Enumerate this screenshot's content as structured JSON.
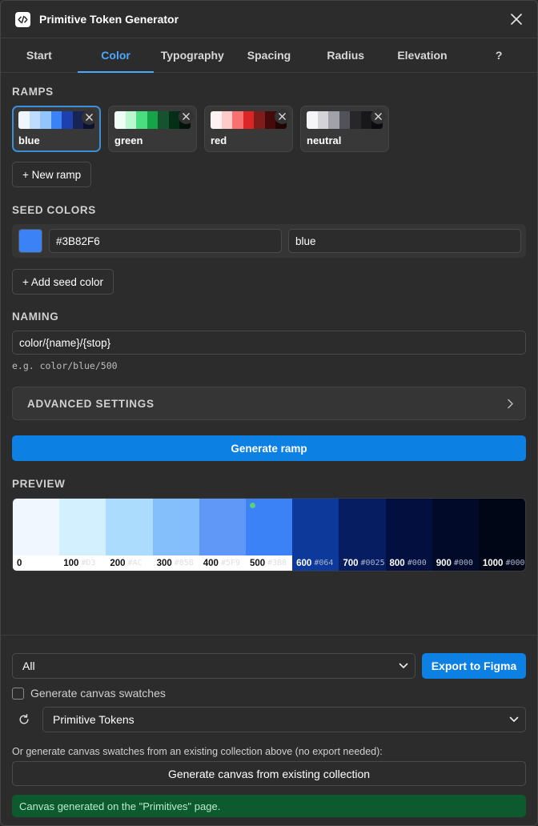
{
  "app": {
    "title": "Primitive Token Generator"
  },
  "tabs": [
    {
      "label": "Start"
    },
    {
      "label": "Color"
    },
    {
      "label": "Typography"
    },
    {
      "label": "Spacing"
    },
    {
      "label": "Radius"
    },
    {
      "label": "Elevation"
    },
    {
      "label": "?"
    }
  ],
  "active_tab": "Color",
  "ramps": {
    "label": "RAMPS",
    "items": [
      {
        "name": "blue",
        "selected": true,
        "colors": [
          "#eff6ff",
          "#bfdbfe",
          "#93c5fd",
          "#3b82f6",
          "#1e40af",
          "#172554",
          "#0b1230"
        ]
      },
      {
        "name": "green",
        "selected": false,
        "colors": [
          "#f0fdf4",
          "#bbf7d0",
          "#4ade80",
          "#16a34a",
          "#14532d",
          "#052e16",
          "#02140a"
        ]
      },
      {
        "name": "red",
        "selected": false,
        "colors": [
          "#fef2f2",
          "#fecaca",
          "#f87171",
          "#dc2626",
          "#7f1d1d",
          "#450a0a",
          "#200505"
        ]
      },
      {
        "name": "neutral",
        "selected": false,
        "colors": [
          "#f5f5f7",
          "#d4d4d8",
          "#a1a1aa",
          "#52525b",
          "#27272a",
          "#18181b",
          "#0c0c0e"
        ]
      }
    ],
    "new_label": "+ New ramp"
  },
  "seed": {
    "label": "SEED COLORS",
    "color": "#3B82F6",
    "hex": "#3B82F6",
    "name": "blue",
    "add_label": "+ Add seed color"
  },
  "naming": {
    "label": "NAMING",
    "pattern": "color/{name}/{stop}",
    "example": "e.g. color/blue/500"
  },
  "advanced": {
    "label": "ADVANCED SETTINGS"
  },
  "generate_label": "Generate ramp",
  "preview": {
    "label": "PREVIEW",
    "stops": [
      {
        "stop": "0",
        "hex": "",
        "color": "#f1f7ff",
        "dark": false
      },
      {
        "stop": "100",
        "hex": "#D3",
        "color": "#d3f0fe",
        "dark": false
      },
      {
        "stop": "200",
        "hex": "#AC",
        "color": "#acdcfd",
        "dark": false
      },
      {
        "stop": "300",
        "hex": "#85B",
        "color": "#85bffb",
        "dark": false
      },
      {
        "stop": "400",
        "hex": "#5F9",
        "color": "#5f98f7",
        "dark": false
      },
      {
        "stop": "500",
        "hex": "#3B8",
        "color": "#3b82f6",
        "dark": false,
        "seed": true
      },
      {
        "stop": "600",
        "hex": "#064",
        "color": "#0d3a9a",
        "dark": true
      },
      {
        "stop": "700",
        "hex": "#0025",
        "color": "#061d62",
        "dark": true
      },
      {
        "stop": "800",
        "hex": "#000",
        "color": "#030f3f",
        "dark": true
      },
      {
        "stop": "900",
        "hex": "#000",
        "color": "#020a29",
        "dark": true
      },
      {
        "stop": "1000",
        "hex": "#000",
        "color": "#010617",
        "dark": true
      }
    ]
  },
  "footer": {
    "scope_value": "All",
    "export_label": "Export to Figma",
    "swatches_label": "Generate canvas swatches",
    "collection_value": "Primitive Tokens",
    "or_text": "Or generate canvas swatches from an existing collection above (no export needed):",
    "from_collection_label": "Generate canvas from existing collection",
    "status": "Canvas generated on the \"Primitives\" page."
  },
  "colors": {
    "accent": "#0d80e3",
    "tab_active": "#4aa8ff",
    "success_bg": "#0d5a2f"
  }
}
